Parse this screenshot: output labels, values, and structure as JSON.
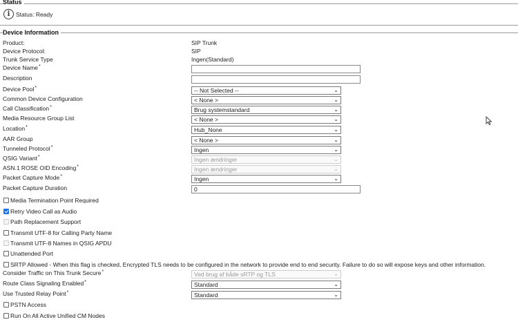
{
  "status": {
    "section_title": "Status",
    "message": "Status: Ready"
  },
  "device_info": {
    "section_title": "Device Information",
    "static_rows": [
      {
        "label": "Product:",
        "value": "SIP Trunk"
      },
      {
        "label": "Device Protocol:",
        "value": "SIP"
      },
      {
        "label": "Trunk Service Type",
        "value": "Ingen(Standard)"
      }
    ],
    "device_name": {
      "label": "Device Name",
      "required": "*",
      "value": ""
    },
    "description": {
      "label": "Description",
      "value": ""
    },
    "device_pool": {
      "label": "Device Pool",
      "required": "*",
      "value": "-- Not Selected --"
    },
    "common_device_configuration": {
      "label": "Common Device Configuration",
      "value": "< None >"
    },
    "call_classification": {
      "label": "Call Classification",
      "required": "*",
      "value": "Brug systemstandard"
    },
    "media_resource_group_list": {
      "label": "Media Resource Group List",
      "value": "< None >"
    },
    "location": {
      "label": "Location",
      "required": "*",
      "value": "Hub_None"
    },
    "aar_group": {
      "label": "AAR Group",
      "value": "< None >"
    },
    "tunneled_protocol": {
      "label": "Tunneled Protocol",
      "required": "*",
      "value": "Ingen"
    },
    "qsig_variant": {
      "label": "QSIG Variant",
      "required": "*",
      "value": "Ingen ændringer"
    },
    "asn1_rose_oid_encoding": {
      "label": "ASN.1 ROSE OID Encoding",
      "required": "*",
      "value": "Ingen ændringer"
    },
    "packet_capture_mode": {
      "label": "Packet Capture Mode",
      "required": "*",
      "value": "Ingen"
    },
    "packet_capture_duration": {
      "label": "Packet Capture Duration",
      "value": "0"
    },
    "checkboxes": [
      {
        "label": "Media Termination Point Required",
        "checked": false,
        "disabled": false
      },
      {
        "label": "Retry Video Call as Audio",
        "checked": true,
        "disabled": false
      },
      {
        "label": "Path Replacement Support",
        "checked": false,
        "disabled": true
      },
      {
        "label": "Transmit UTF-8 for Calling Party Name",
        "checked": false,
        "disabled": false
      },
      {
        "label": "Transmit UTF-8 Names in QSIG APDU",
        "checked": false,
        "disabled": true
      },
      {
        "label": "Unattended Port",
        "checked": false,
        "disabled": false
      },
      {
        "label": "SRTP Allowed - When this flag is checked, Encrypted TLS needs to be configured in the network to provide end to end security. Failure to do so will expose keys and other information.",
        "checked": false,
        "disabled": false
      }
    ],
    "consider_traffic_secure": {
      "label": "Consider Traffic on This Trunk Secure",
      "required": "*",
      "value": "Ved brug af både sRTP og TLS"
    },
    "route_class_signaling": {
      "label": "Route Class Signaling Enabled",
      "required": "*",
      "value": "Standard"
    },
    "use_trusted_relay_point": {
      "label": "Use Trusted Relay Point",
      "required": "*",
      "value": "Standard"
    },
    "bottom_checkboxes": [
      {
        "label": "PSTN Access",
        "checked": false,
        "disabled": false
      },
      {
        "label": "Run On All Active Unified CM Nodes",
        "checked": false,
        "disabled": false
      }
    ]
  },
  "icons": {
    "info": "info-icon",
    "dropdown": "chevron-down-icon",
    "cursor": "mouse-cursor-icon"
  }
}
